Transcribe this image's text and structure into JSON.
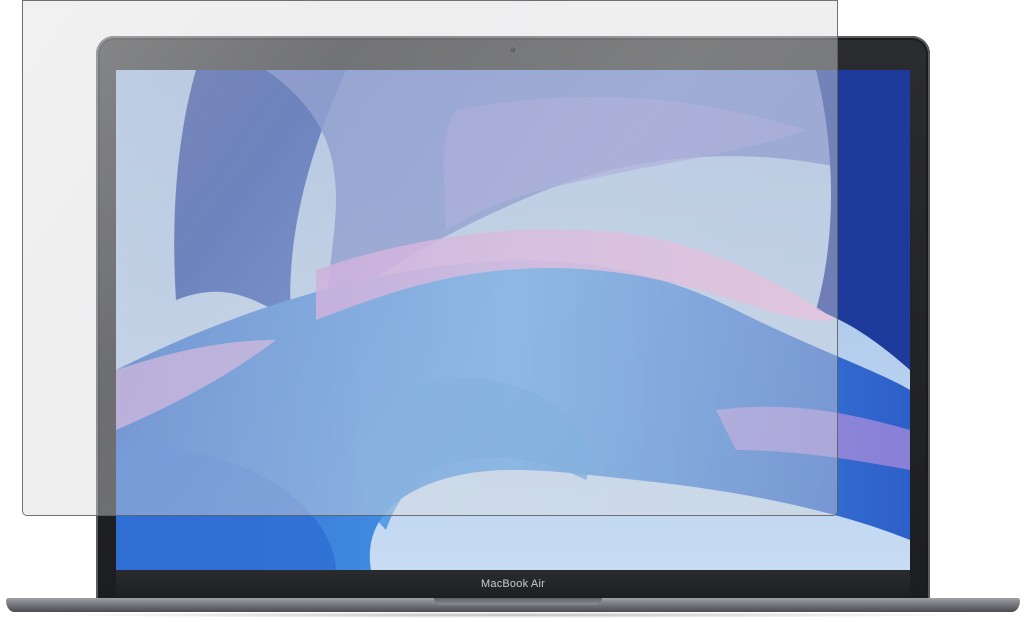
{
  "product": {
    "brand_label": "MacBook Air"
  },
  "icons": {
    "camera": "camera-icon"
  },
  "colors": {
    "bezel": "#1c1d20",
    "body": "#77797e",
    "wallpaper_blue": "#3f7ed3",
    "wallpaper_pink": "#e6a8dc",
    "wallpaper_navy": "#1e3f9e",
    "film_tint": "#d6d6da"
  }
}
